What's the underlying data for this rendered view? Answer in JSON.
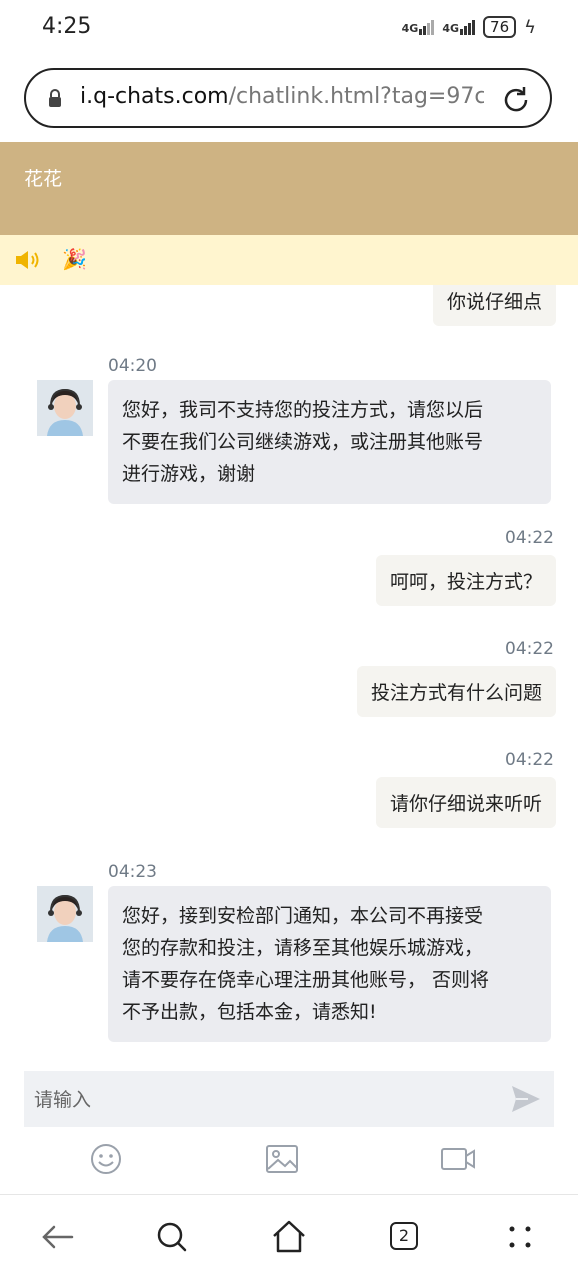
{
  "status_bar": {
    "time": "4:25",
    "network_1": "4G",
    "network_2": "4G",
    "battery": "76"
  },
  "browser": {
    "url_host": "i.q-chats.com",
    "url_path": "/chatlink.html?tag=97c",
    "tab_count": "2"
  },
  "chat": {
    "title": "花花",
    "messages": [
      {
        "side": "right",
        "time": "",
        "text": "你说仔细点"
      },
      {
        "side": "left",
        "time": "04:20",
        "lines": [
          "您好，我司不支持您的投注方式，请您以后",
          "不要在我们公司继续游戏，或注册其他账号",
          "进行游戏，谢谢"
        ]
      },
      {
        "side": "right",
        "time": "04:22",
        "text": "呵呵，投注方式？"
      },
      {
        "side": "right",
        "time": "04:22",
        "text": "投注方式有什么问题"
      },
      {
        "side": "right",
        "time": "04:22",
        "text": "请你仔细说来听听"
      },
      {
        "side": "left",
        "time": "04:23",
        "lines": [
          "您好，接到安检部门通知，本公司不再接受",
          "您的存款和投注，请移至其他娱乐城游戏，",
          "请不要存在侥幸心理注册其他账号， 否则将",
          "不予出款，包括本金，请悉知!"
        ]
      }
    ]
  },
  "input": {
    "placeholder": "请输入"
  },
  "colors": {
    "header_bg": "#ceb383",
    "notice_bg": "#fff5cf",
    "agent_bubble": "#ebecf0",
    "user_bubble": "#f5f4f0"
  },
  "icons": [
    "lock-icon",
    "reload-icon",
    "speaker-icon",
    "party-icon",
    "send-icon",
    "emoji-icon",
    "image-icon",
    "video-icon",
    "back-icon",
    "search-icon",
    "home-icon",
    "menu-icon"
  ]
}
